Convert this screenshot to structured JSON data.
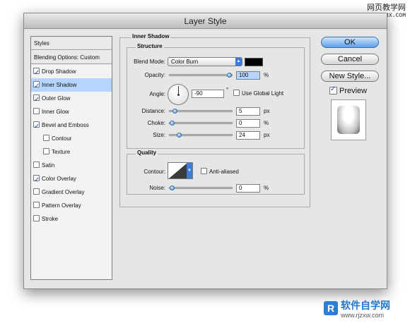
{
  "watermark_top": {
    "line1": "网页教学网",
    "url": "WWW.WEB3X.COM"
  },
  "watermark_bottom": {
    "cn": "软件自学网",
    "url": "www.rjzxw.com"
  },
  "window": {
    "title": "Layer Style"
  },
  "sidebar": {
    "styles_label": "Styles",
    "blending_label": "Blending Options: Custom",
    "items": [
      {
        "label": "Drop Shadow",
        "checked": true
      },
      {
        "label": "Inner Shadow",
        "checked": true,
        "selected": true
      },
      {
        "label": "Outer Glow",
        "checked": true
      },
      {
        "label": "Inner Glow",
        "checked": false
      },
      {
        "label": "Bevel and Emboss",
        "checked": true
      },
      {
        "label": "Contour",
        "checked": false,
        "indent": true
      },
      {
        "label": "Texture",
        "checked": false,
        "indent": true
      },
      {
        "label": "Satin",
        "checked": false
      },
      {
        "label": "Color Overlay",
        "checked": true
      },
      {
        "label": "Gradient Overlay",
        "checked": false
      },
      {
        "label": "Pattern Overlay",
        "checked": false
      },
      {
        "label": "Stroke",
        "checked": false
      }
    ]
  },
  "panel": {
    "section_title": "Inner Shadow",
    "structure": {
      "title": "Structure",
      "blend_mode_label": "Blend Mode:",
      "blend_mode_value": "Color Burn",
      "blend_color": "#000000",
      "opacity_label": "Opacity:",
      "opacity_value": "100",
      "opacity_unit": "%",
      "opacity_level": 1.0,
      "angle_label": "Angle:",
      "angle_value": "-90",
      "angle_unit": "°",
      "use_global_light_label": "Use Global Light",
      "use_global_light": false,
      "distance_label": "Distance:",
      "distance_value": "5",
      "distance_unit": "px",
      "distance_level": 0.05,
      "choke_label": "Choke:",
      "choke_value": "0",
      "choke_unit": "%",
      "choke_level": 0.0,
      "size_label": "Size:",
      "size_value": "24",
      "size_unit": "px",
      "size_level": 0.12
    },
    "quality": {
      "title": "Quality",
      "contour_label": "Contour:",
      "anti_aliased_label": "Anti-aliased",
      "anti_aliased": false,
      "noise_label": "Noise:",
      "noise_value": "0",
      "noise_unit": "%",
      "noise_level": 0.0
    }
  },
  "buttons": {
    "ok": "OK",
    "cancel": "Cancel",
    "new_style": "New Style...",
    "preview_label": "Preview",
    "preview_checked": true
  },
  "colors": {
    "selection": "#b5d5ff",
    "accent": "#3b7be0"
  }
}
